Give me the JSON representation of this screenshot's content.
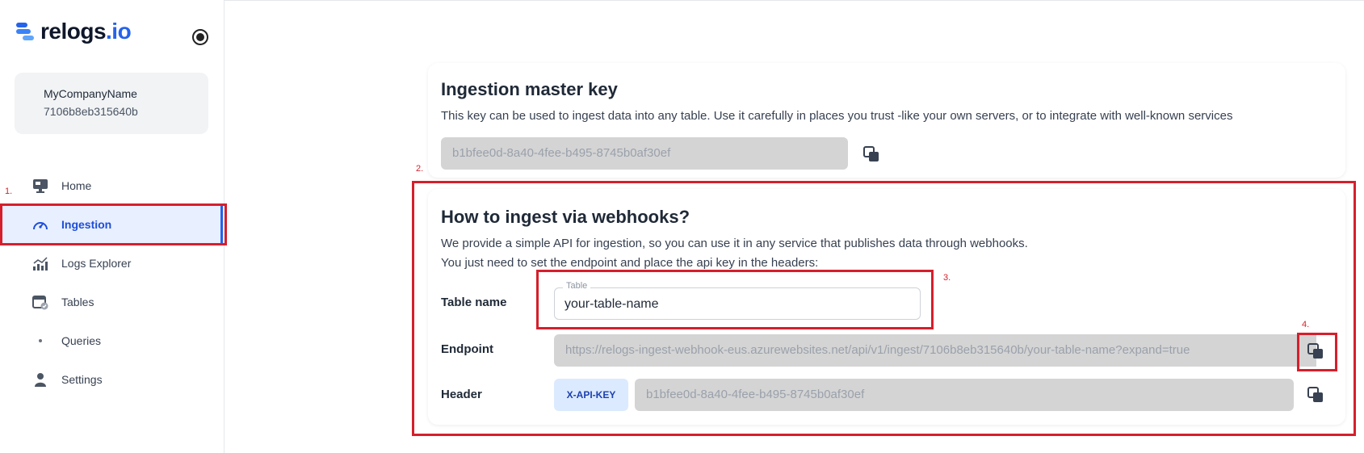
{
  "app": {
    "logo_text_main": "relogs",
    "logo_text_dot": ".io",
    "brand_color": "#2563eb"
  },
  "company": {
    "name": "MyCompanyName",
    "id": "7106b8eb315640b"
  },
  "sidebar": {
    "items": [
      {
        "label": "Home",
        "icon": "monitor-icon",
        "active": false
      },
      {
        "label": "Ingestion",
        "icon": "speedometer-icon",
        "active": true
      },
      {
        "label": "Logs Explorer",
        "icon": "chart-icon",
        "active": false
      },
      {
        "label": "Tables",
        "icon": "calendar-check-icon",
        "active": false
      },
      {
        "label": "Queries",
        "icon": "dot-icon",
        "active": false
      },
      {
        "label": "Settings",
        "icon": "user-icon",
        "active": false
      }
    ]
  },
  "master_key": {
    "title": "Ingestion master key",
    "description": "This key can be used to ingest data into any table. Use it carefully in places you trust -like your own servers, or to integrate with well-known services",
    "key": "b1bfee0d-8a40-4fee-b495-8745b0af30ef"
  },
  "webhooks": {
    "title": "How to ingest via webhooks?",
    "description_line1": "We provide a simple API for ingestion, so you can use it in any service that publishes data through webhooks.",
    "description_line2": "You just need to set the endpoint and place the api key in the headers:",
    "table_label": "Table name",
    "table_field_legend": "Table",
    "table_field_value": "your-table-name",
    "endpoint_label": "Endpoint",
    "endpoint_value": "https://relogs-ingest-webhook-eus.azurewebsites.net/api/v1/ingest/7106b8eb315640b/your-table-name?expand=true",
    "header_label": "Header",
    "header_key_name": "X-API-KEY",
    "header_key_value": "b1bfee0d-8a40-4fee-b495-8745b0af30ef"
  },
  "annotations": {
    "n1": "1.",
    "n2": "2.",
    "n3": "3.",
    "n4": "4.",
    "color": "#d61f2c"
  }
}
